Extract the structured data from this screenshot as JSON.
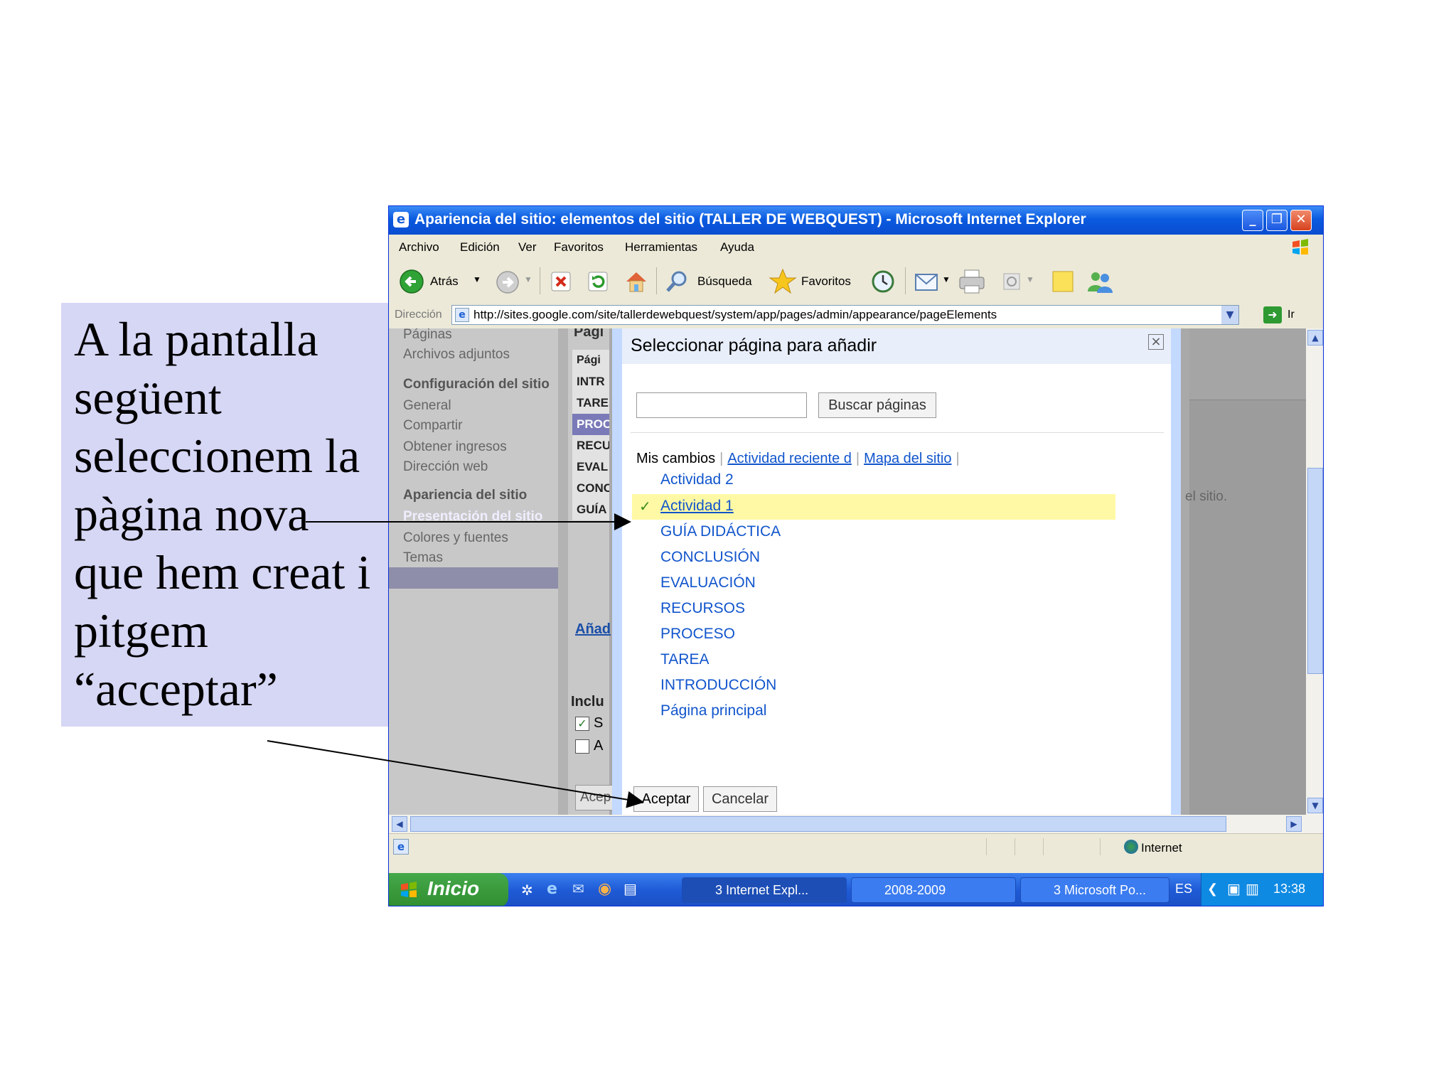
{
  "annotation": {
    "text": "A la pantalla\nsegüent\nseleccionem la\npàgina nova\nque hem creat i\npitgem\n“acceptar”"
  },
  "window": {
    "title": "Apariencia del sitio: elementos del sitio (TALLER DE WEBQUEST) - Microsoft Internet Explorer"
  },
  "menu": [
    "Archivo",
    "Edición",
    "Ver",
    "Favoritos",
    "Herramientas",
    "Ayuda"
  ],
  "toolbar": {
    "back_label": "Atrás",
    "search_label": "Búsqueda",
    "favorites_label": "Favoritos"
  },
  "address": {
    "label": "Dirección",
    "url": "http://sites.google.com/site/tallerdewebquest/system/app/pages/admin/appearance/pageElements",
    "go_label": "Ir"
  },
  "sidebar": {
    "items": [
      {
        "label": "Páginas",
        "kind": "item"
      },
      {
        "label": "Archivos adjuntos",
        "kind": "item"
      },
      {
        "label": "Configuración del sitio",
        "kind": "heading"
      },
      {
        "label": "General",
        "kind": "item"
      },
      {
        "label": "Compartir",
        "kind": "item"
      },
      {
        "label": "Obtener ingresos",
        "kind": "item"
      },
      {
        "label": "Dirección web",
        "kind": "item"
      },
      {
        "label": "Apariencia del sitio",
        "kind": "heading"
      },
      {
        "label": "Presentación del sitio",
        "kind": "active"
      },
      {
        "label": "Colores y fuentes",
        "kind": "item"
      },
      {
        "label": "Temas",
        "kind": "item"
      }
    ]
  },
  "background": {
    "column_header": "Pági",
    "column_title": "Pági",
    "cells": [
      "INTR",
      "TARE",
      "PROC",
      "RECU",
      "EVAL",
      "CONC",
      "GUÍA"
    ],
    "add_link": "Añad",
    "include_label": "Inclu",
    "check1_label": "S",
    "check2_label": "A",
    "accept_partial": "Acep",
    "right_note": "el sitio."
  },
  "dialog": {
    "title": "Seleccionar página para añadir",
    "close": "×",
    "search_placeholder": "",
    "search_button": "Buscar páginas",
    "tabs": {
      "current": "Mis cambios",
      "recent": "Actividad reciente d",
      "sitemap": "Mapa del sitio"
    },
    "pages": [
      "Actividad 2",
      "Actividad 1",
      "GUÍA DIDÁCTICA",
      "CONCLUSIÓN",
      "EVALUACIÓN",
      "RECURSOS",
      "PROCESO",
      "TAREA",
      "INTRODUCCIÓN",
      "Página principal"
    ],
    "selected_page": "Actividad 1",
    "accept": "Aceptar",
    "cancel": "Cancelar"
  },
  "statusbar": {
    "zone": "Internet"
  },
  "taskbar": {
    "start": "Inicio",
    "tasks": [
      "3 Internet Expl...",
      "2008-2009",
      "3 Microsoft Po..."
    ],
    "language": "ES",
    "clock": "13:38"
  },
  "colors": {
    "annotation_bg": "#d6d6f5",
    "titlebar": "#0a5be0",
    "link": "#1155cc",
    "selected_row": "#fff9a5"
  }
}
